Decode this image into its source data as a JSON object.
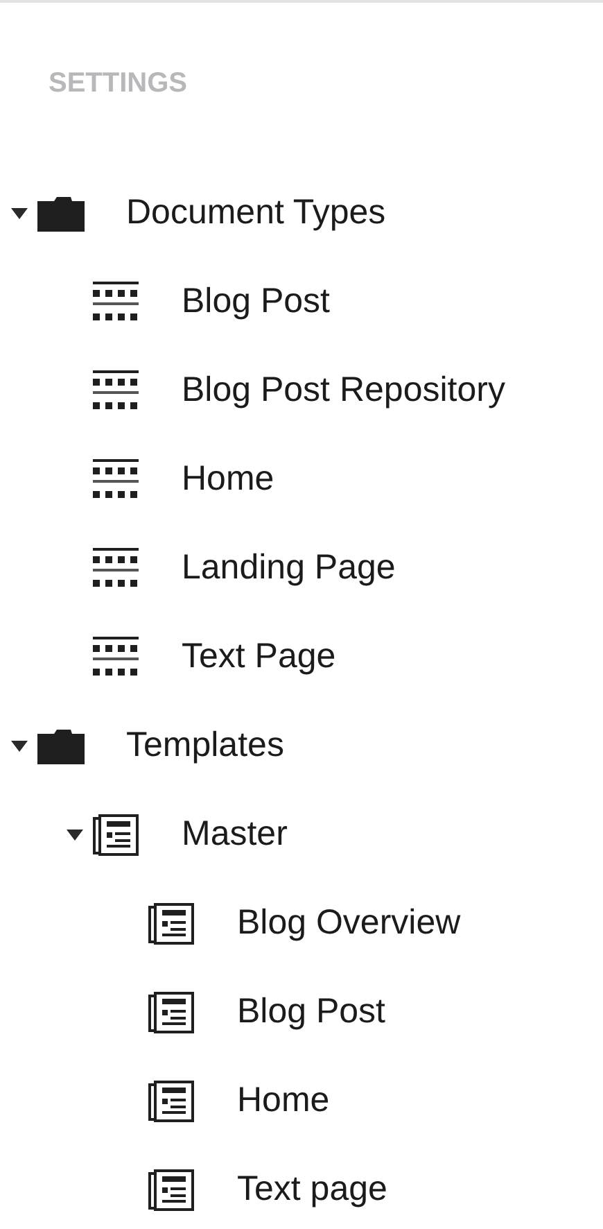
{
  "section_title": "SETTINGS",
  "tree": [
    {
      "label": "Document Types",
      "kind": "folder",
      "expanded": true,
      "children": [
        {
          "label": "Blog Post",
          "kind": "doctype"
        },
        {
          "label": "Blog Post Repository",
          "kind": "doctype"
        },
        {
          "label": "Home",
          "kind": "doctype"
        },
        {
          "label": "Landing Page",
          "kind": "doctype"
        },
        {
          "label": "Text Page",
          "kind": "doctype"
        }
      ]
    },
    {
      "label": "Templates",
      "kind": "folder",
      "expanded": true,
      "children": [
        {
          "label": "Master",
          "kind": "template",
          "expanded": true,
          "children": [
            {
              "label": "Blog Overview",
              "kind": "template"
            },
            {
              "label": "Blog Post",
              "kind": "template"
            },
            {
              "label": "Home",
              "kind": "template"
            },
            {
              "label": "Text page",
              "kind": "template"
            }
          ]
        }
      ]
    }
  ]
}
